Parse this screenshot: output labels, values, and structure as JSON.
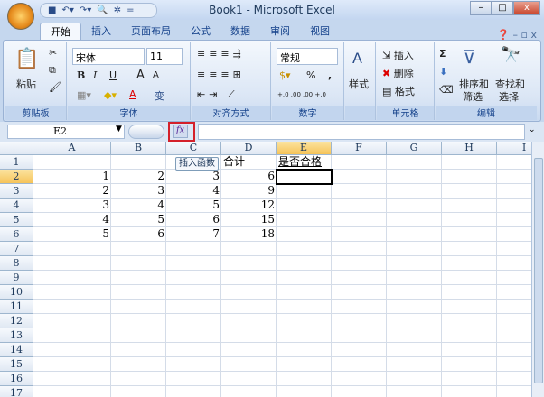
{
  "window": {
    "title": "Book1 - Microsoft Excel",
    "minimize": "–",
    "maximize": "□",
    "close": "x"
  },
  "qat": {
    "items": [
      "save",
      "undo ▾",
      "redo ▾",
      "print-preview",
      "tools"
    ],
    "more": "="
  },
  "tabs": [
    "开始",
    "插入",
    "页面布局",
    "公式",
    "数据",
    "审阅",
    "视图"
  ],
  "active_tab": "开始",
  "ribbon": {
    "clipboard": {
      "label": "剪贴板",
      "paste": "粘贴"
    },
    "font": {
      "label": "字体",
      "name": "宋体",
      "size": "11",
      "bold": "B",
      "italic": "I",
      "underline": "U",
      "grow": "A",
      "shrink": "A",
      "color": "A",
      "phonetic": "变"
    },
    "align": {
      "label": "对齐方式"
    },
    "number": {
      "label": "数字",
      "format": "常规",
      "percent": "%",
      "comma": ",",
      "inc": "+.0 .00",
      "dec": ".00 +.0"
    },
    "styles": {
      "label": "样式",
      "button": "样式"
    },
    "cells": {
      "label": "单元格",
      "insert": "插入",
      "delete": "删除",
      "format": "格式"
    },
    "editing": {
      "label": "编辑",
      "sum": "Σ",
      "sort": "排序和\n筛选",
      "sort1": "排序和",
      "sort2": "筛选",
      "find1": "查找和",
      "find2": "选择"
    }
  },
  "formula_bar": {
    "name_box": "E2",
    "fx": "fx",
    "value": ""
  },
  "tooltip": "插入函数",
  "columns": [
    "A",
    "B",
    "C",
    "D",
    "E",
    "F",
    "G",
    "H",
    "I"
  ],
  "rows": [
    "1",
    "2",
    "3",
    "4",
    "5",
    "6",
    "7",
    "8",
    "9",
    "10",
    "11",
    "12",
    "13",
    "14",
    "15",
    "16",
    "17"
  ],
  "cells": {
    "D1": "合计",
    "E1": "是否合格",
    "r2": [
      "1",
      "2",
      "3",
      "6"
    ],
    "r3": [
      "2",
      "3",
      "4",
      "9"
    ],
    "r4": [
      "3",
      "4",
      "5",
      "12"
    ],
    "r5": [
      "4",
      "5",
      "6",
      "15"
    ],
    "r6": [
      "5",
      "6",
      "7",
      "18"
    ]
  },
  "selected_cell": "E2"
}
